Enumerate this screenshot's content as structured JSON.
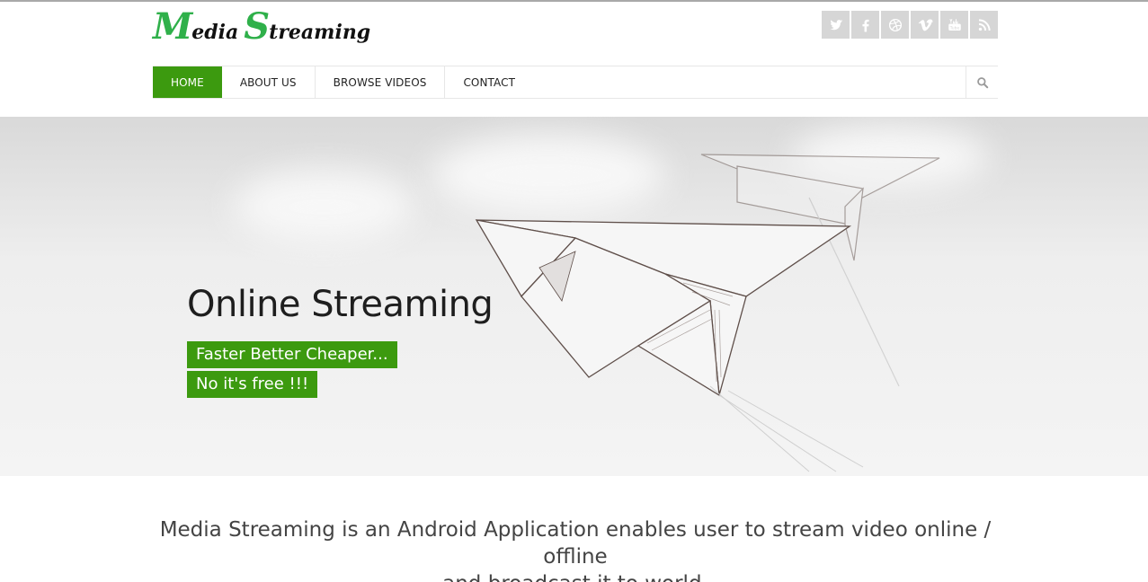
{
  "brand": {
    "word1_initial": "M",
    "word1_rest": "edia",
    "word2_initial": "S",
    "word2_rest": "treaming",
    "colors": {
      "initials": "#2fb04a",
      "rest": "#111111"
    }
  },
  "social": [
    {
      "icon": "twitter-icon"
    },
    {
      "icon": "facebook-icon"
    },
    {
      "icon": "dribbble-icon"
    },
    {
      "icon": "vimeo-icon"
    },
    {
      "icon": "youtube-icon"
    },
    {
      "icon": "rss-icon"
    }
  ],
  "nav": {
    "items": [
      {
        "label": "HOME",
        "active": true
      },
      {
        "label": "ABOUT US",
        "active": false
      },
      {
        "label": "BROWSE VIDEOS",
        "active": false
      },
      {
        "label": "CONTACT",
        "active": false
      }
    ],
    "search_icon": "search-icon",
    "accent_color": "#3c9a0f"
  },
  "hero": {
    "title": "Online Streaming",
    "taglines": [
      "Faster Better Cheaper...",
      "No it's free !!!"
    ]
  },
  "intro": {
    "line1": "Media Streaming is an Android Application enables user to stream video online / offline",
    "line2": "and broadcast it to world."
  }
}
